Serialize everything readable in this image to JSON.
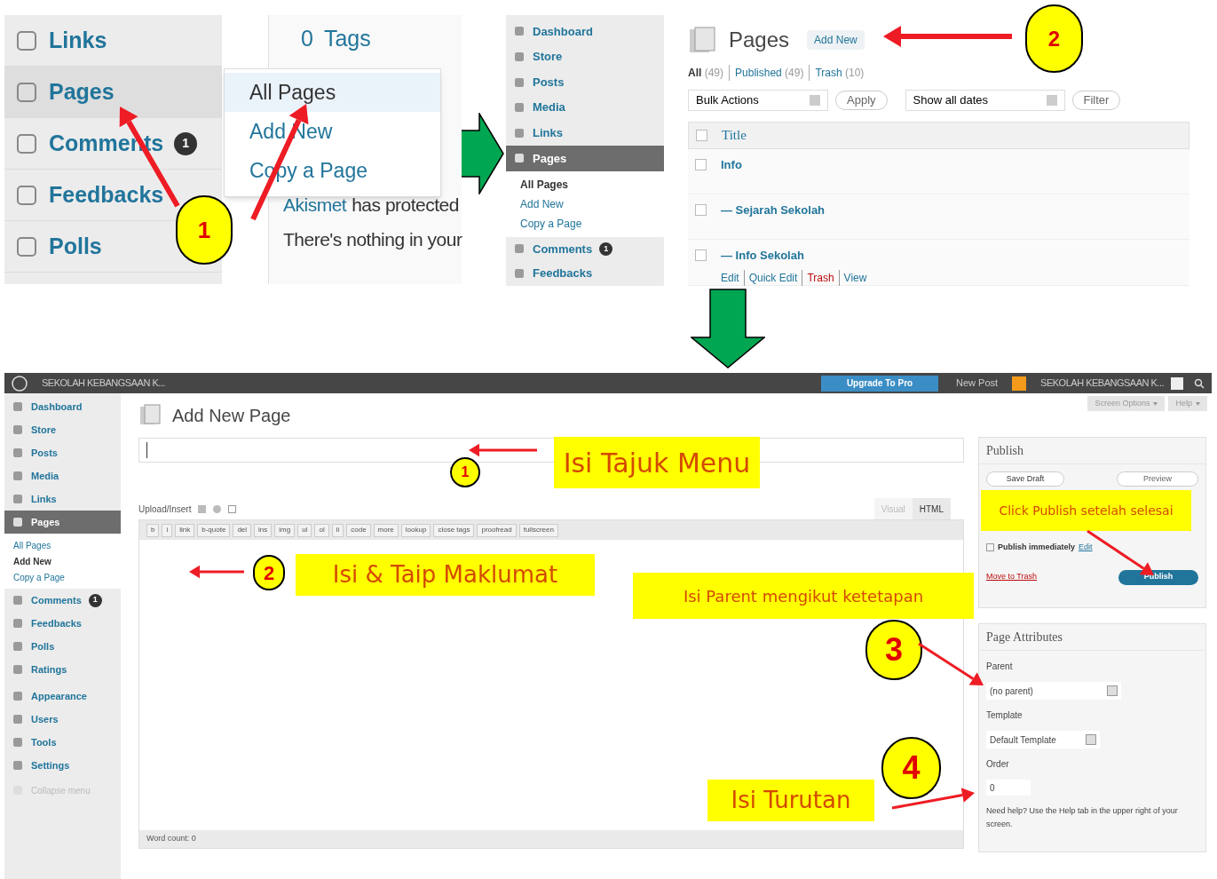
{
  "panel_1": {
    "menu": [
      {
        "label": "Links",
        "selected": false
      },
      {
        "label": "Pages",
        "selected": true
      },
      {
        "label": "Comments",
        "selected": false,
        "badge": "1"
      },
      {
        "label": "Feedbacks",
        "selected": false
      },
      {
        "label": "Polls",
        "selected": false
      }
    ],
    "submenu": [
      {
        "label": "All Pages",
        "selected": true
      },
      {
        "label": "Add New",
        "selected": false
      },
      {
        "label": "Copy a Page",
        "selected": false
      }
    ],
    "tags_count": "0",
    "tags_label": "Tags",
    "akismet_link": "Akismet",
    "akismet_text": "has protected",
    "nothing_text": "There's nothing in your",
    "callout": "1"
  },
  "panel_2": {
    "menu": [
      {
        "label": "Dashboard",
        "selected": false
      },
      {
        "label": "Store",
        "selected": false
      },
      {
        "label": "Posts",
        "selected": false
      },
      {
        "label": "Media",
        "selected": false
      },
      {
        "label": "Links",
        "selected": false
      },
      {
        "label": "Pages",
        "selected": true
      }
    ],
    "submenu": [
      {
        "label": "All Pages",
        "selected": true
      },
      {
        "label": "Add New",
        "selected": false
      },
      {
        "label": "Copy a Page",
        "selected": false
      }
    ],
    "menu_after": [
      {
        "label": "Comments",
        "selected": false,
        "badge": "1"
      },
      {
        "label": "Feedbacks",
        "selected": false
      }
    ],
    "title": "Pages",
    "add_new": "Add New",
    "filters": [
      {
        "label": "All",
        "count": "(49)",
        "selected": true
      },
      {
        "label": "Published",
        "count": "(49)",
        "selected": false
      },
      {
        "label": "Trash",
        "count": "(10)",
        "selected": false
      }
    ],
    "bulk_actions": "Bulk Actions",
    "apply": "Apply",
    "dates": "Show all dates",
    "filter": "Filter",
    "column": "Title",
    "column_checked": false,
    "rows": [
      {
        "title": "Info",
        "checked": false
      },
      {
        "title": "— Sejarah Sekolah",
        "checked": false
      },
      {
        "title": "— Info Sekolah",
        "checked": false,
        "actions": [
          {
            "label": "Edit",
            "kind": "link"
          },
          {
            "label": "Quick Edit",
            "kind": "link"
          },
          {
            "label": "Trash",
            "kind": "delete"
          },
          {
            "label": "View",
            "kind": "link"
          }
        ]
      }
    ],
    "callout": "2"
  },
  "editor": {
    "admin_bar": {
      "site": "SEKOLAH KEBANGSAAN K...",
      "upgrade": "Upgrade To Pro",
      "new_post": "New Post",
      "site_right": "SEKOLAH KEBANGSAAN K..."
    },
    "menu": [
      {
        "label": "Dashboard",
        "selected": false
      },
      {
        "label": "Store",
        "selected": false
      },
      {
        "label": "Posts",
        "selected": false
      },
      {
        "label": "Media",
        "selected": false
      },
      {
        "label": "Links",
        "selected": false
      },
      {
        "label": "Pages",
        "selected": true
      }
    ],
    "submenu": [
      {
        "label": "All Pages",
        "selected": false
      },
      {
        "label": "Add New",
        "selected": true
      },
      {
        "label": "Copy a Page",
        "selected": false
      }
    ],
    "menu_after": [
      {
        "label": "Comments",
        "selected": false,
        "badge": "1"
      },
      {
        "label": "Feedbacks",
        "selected": false
      },
      {
        "label": "Polls",
        "selected": false
      },
      {
        "label": "Ratings",
        "selected": false
      }
    ],
    "menu_lower": [
      {
        "label": "Appearance",
        "selected": false
      },
      {
        "label": "Users",
        "selected": false
      },
      {
        "label": "Tools",
        "selected": false
      },
      {
        "label": "Settings",
        "selected": false
      }
    ],
    "collapse": "Collapse menu",
    "screen_options": "Screen Options",
    "help": "Help",
    "heading": "Add New Page",
    "upload": "Upload/Insert",
    "tabs": [
      {
        "label": "Visual",
        "selected": false
      },
      {
        "label": "HTML",
        "selected": true
      }
    ],
    "toolbar": [
      "b",
      "i",
      "link",
      "b-quote",
      "del",
      "ins",
      "img",
      "ul",
      "ol",
      "li",
      "code",
      "more",
      "lookup",
      "close tags",
      "proofread",
      "fullscreen"
    ],
    "word_count": "Word count: 0",
    "publish": {
      "title": "Publish",
      "save_draft": "Save Draft",
      "preview": "Preview",
      "immediately": "Publish immediately",
      "edit": "Edit",
      "trash": "Move to Trash",
      "publish": "Publish"
    },
    "attributes": {
      "title": "Page Attributes",
      "parent_label": "Parent",
      "parent_value": "(no parent)",
      "template_label": "Template",
      "template_value": "Default Template",
      "order_label": "Order",
      "order_value": "0",
      "help": "Need help? Use the Help tab in the upper right of your screen."
    }
  },
  "annotations": {
    "step_1": "1",
    "title_note": "Isi Tajuk Menu",
    "step_2": "2",
    "content_note": "Isi & Taip Maklumat",
    "parent_note": "Isi Parent mengikut ketetapan",
    "publish_note": "Click Publish setelah selesai",
    "step_3": "3",
    "step_4": "4",
    "order_note": "Isi Turutan"
  }
}
